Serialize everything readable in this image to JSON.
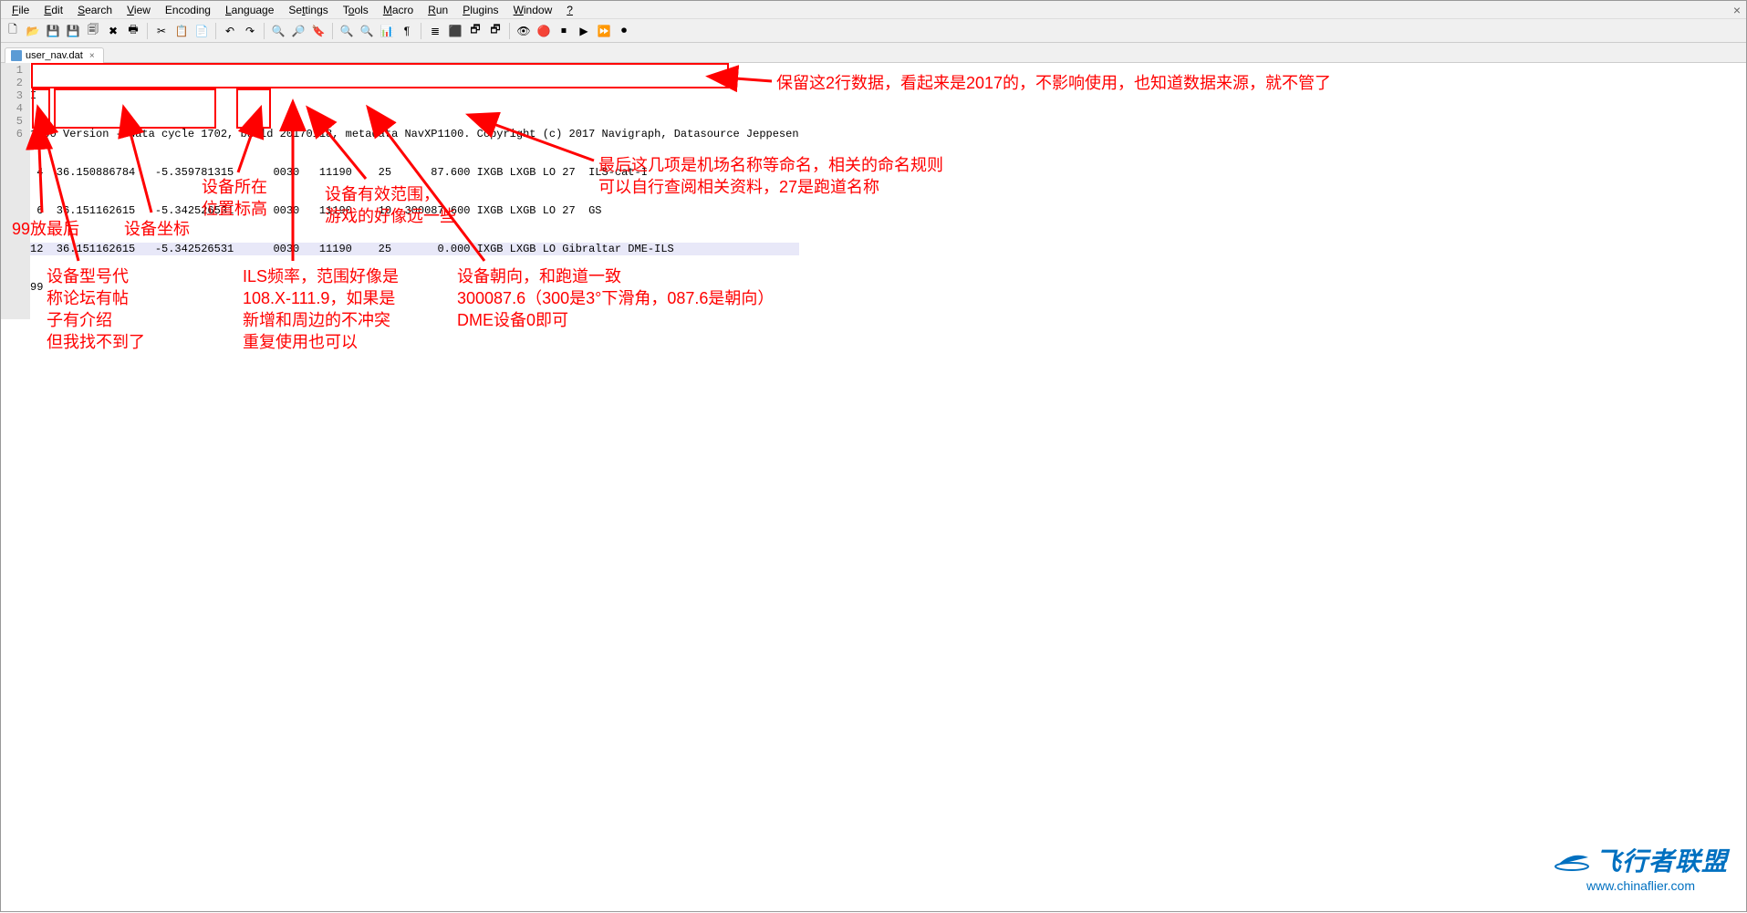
{
  "menu": [
    "File",
    "Edit",
    "Search",
    "View",
    "Encoding",
    "Language",
    "Settings",
    "Tools",
    "Macro",
    "Run",
    "Plugins",
    "Window",
    "?"
  ],
  "tab": {
    "name": "user_nav.dat",
    "close": "×"
  },
  "window_close": "×",
  "gutter": [
    "1",
    "2",
    "3",
    "4",
    "5",
    "6"
  ],
  "code_lines": [
    "I",
    "1100 Version - data cycle 1702, build 20170118, metadata NavXP1100. Copyright (c) 2017 Navigraph, Datasource Jeppesen",
    " 4  36.150886784   -5.359781315      0030   11190    25      87.600 IXGB LXGB LO 27  ILS-cat-I",
    " 6  36.151162615   -5.342526531      0030   11190    10  300087.600 IXGB LXGB LO 27  GS",
    "12  36.151162615   -5.342526531      0030   11190    25       0.000 IXGB LXGB LO Gibraltar DME-ILS",
    "99"
  ],
  "annotations": {
    "header_keep": "保留这2行数据，看起来是2017的，不影响使用，也知道数据来源，就不管了",
    "last_items": "最后这几项是机场名称等命名，相关的命名规则\n可以自行查阅相关资料，27是跑道名称",
    "bearing": "设备朝向，和跑道一致\n300087.6（300是3°下滑角，087.6是朝向）\nDME设备0即可",
    "range": "设备有效范围，\n游戏的好像远一些",
    "ils_freq": "ILS频率，范围好像是\n108.X-111.9，如果是\n新增和周边的不冲突\n重复使用也可以",
    "elev": "设备所在\n位置标高",
    "coord": "设备坐标",
    "ninety_nine": "99放最后",
    "type_code": "设备型号代\n称论坛有帖\n子有介绍\n但我找不到了"
  },
  "watermark": {
    "text": "飞行者联盟",
    "url": "www.chinaflier.com"
  },
  "icons": {
    "i1": "🗋",
    "i2": "📂",
    "i3": "💾",
    "i4": "💾",
    "i5": "🗐",
    "i6": "✖",
    "i7": "🖶",
    "sep": "",
    "i8": "✂",
    "i9": "📋",
    "i10": "📄",
    "i11": "↶",
    "i12": "↷",
    "i13": "🔍",
    "i14": "🔎",
    "i15": "🔖",
    "i16": "🔍",
    "i17": "🔍",
    "i18": "📊",
    "i19": "¶",
    "i20": "≣",
    "i21": "⬛",
    "i22": "🗗",
    "i23": "🗗",
    "i24": "👁",
    "i25": "🔴",
    "i26": "⏹",
    "i27": "▶",
    "i28": "⏩",
    "i29": "⏺"
  }
}
